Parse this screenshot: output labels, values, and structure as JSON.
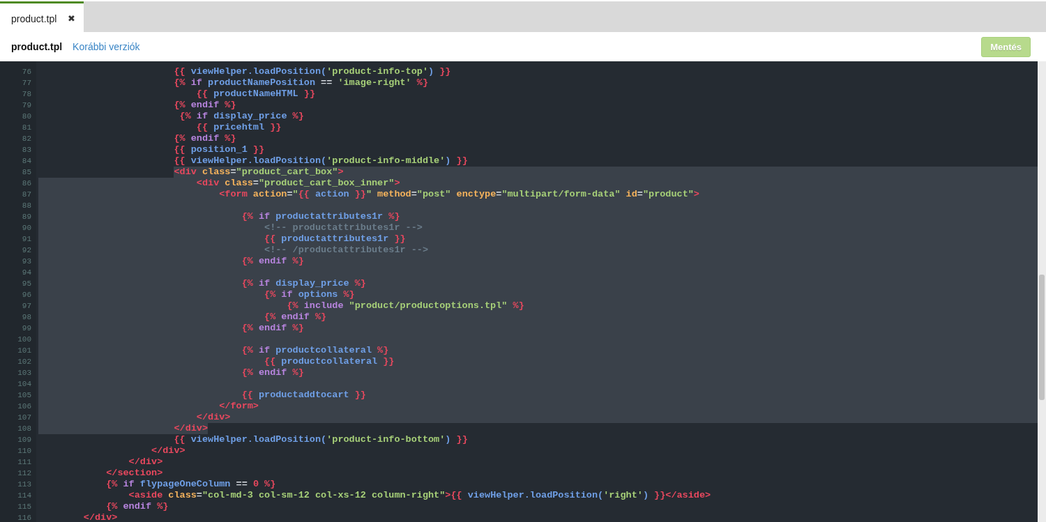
{
  "tabs": [
    {
      "label": "product.tpl",
      "close": "✖",
      "selected": true
    }
  ],
  "toolbar": {
    "file_name": "product.tpl",
    "link": "Korábbi verziók",
    "save_button": {
      "label": "Mentés",
      "disabled": true
    }
  },
  "editor": {
    "lines": [
      {
        "number": "76",
        "selected": false,
        "tokens": [
          {
            "kind": "delim",
            "text": "                        {{"
          },
          {
            "kind": "var",
            "text": " viewHelper.loadPosition("
          },
          {
            "kind": "str",
            "text": "'product-info-top'"
          },
          {
            "kind": "var",
            "text": ") "
          },
          {
            "kind": "delim",
            "text": "}}"
          }
        ]
      },
      {
        "number": "77",
        "selected": false,
        "tokens": [
          {
            "kind": "delim",
            "text": "                        {%"
          },
          {
            "kind": "kw",
            "text": " if"
          },
          {
            "kind": "var",
            "text": " productNamePosition"
          },
          {
            "kind": "op",
            "text": " =="
          },
          {
            "kind": "str",
            "text": " 'image-right'"
          },
          {
            "kind": "delim",
            "text": " %}"
          }
        ]
      },
      {
        "number": "78",
        "selected": false,
        "tokens": [
          {
            "kind": "delim",
            "text": "                            {{"
          },
          {
            "kind": "var",
            "text": " productNameHTML "
          },
          {
            "kind": "delim",
            "text": "}}"
          }
        ]
      },
      {
        "number": "79",
        "selected": false,
        "tokens": [
          {
            "kind": "delim",
            "text": "                        {%"
          },
          {
            "kind": "kw",
            "text": " endif"
          },
          {
            "kind": "delim",
            "text": " %}"
          }
        ]
      },
      {
        "number": "80",
        "selected": false,
        "tokens": [
          {
            "kind": "delim",
            "text": "                         {%"
          },
          {
            "kind": "kw",
            "text": " if"
          },
          {
            "kind": "var",
            "text": " display_price"
          },
          {
            "kind": "delim",
            "text": " %}"
          }
        ]
      },
      {
        "number": "81",
        "selected": false,
        "tokens": [
          {
            "kind": "delim",
            "text": "                            {{"
          },
          {
            "kind": "var",
            "text": " pricehtml "
          },
          {
            "kind": "delim",
            "text": "}}"
          }
        ]
      },
      {
        "number": "82",
        "selected": false,
        "tokens": [
          {
            "kind": "delim",
            "text": "                        {%"
          },
          {
            "kind": "kw",
            "text": " endif"
          },
          {
            "kind": "delim",
            "text": " %}"
          }
        ]
      },
      {
        "number": "83",
        "selected": false,
        "tokens": [
          {
            "kind": "delim",
            "text": "                        {{"
          },
          {
            "kind": "var",
            "text": " position_1 "
          },
          {
            "kind": "delim",
            "text": "}}"
          }
        ]
      },
      {
        "number": "84",
        "selected": false,
        "tokens": [
          {
            "kind": "delim",
            "text": "                        {{"
          },
          {
            "kind": "var",
            "text": " viewHelper.loadPosition("
          },
          {
            "kind": "str",
            "text": "'product-info-middle'"
          },
          {
            "kind": "var",
            "text": ") "
          },
          {
            "kind": "delim",
            "text": "}}"
          }
        ]
      },
      {
        "number": "85",
        "selected": true,
        "tokens": [
          {
            "kind": "tag",
            "text": "                        <div"
          },
          {
            "kind": "attr",
            "text": " class"
          },
          {
            "kind": "op",
            "text": "="
          },
          {
            "kind": "str",
            "text": "\"product_cart_box\""
          },
          {
            "kind": "tag",
            "text": ">"
          }
        ]
      },
      {
        "number": "86",
        "selected": true,
        "tokens": [
          {
            "kind": "tag",
            "text": "                            <div"
          },
          {
            "kind": "attr",
            "text": " class"
          },
          {
            "kind": "op",
            "text": "="
          },
          {
            "kind": "str",
            "text": "\"product_cart_box_inner\""
          },
          {
            "kind": "tag",
            "text": ">"
          }
        ]
      },
      {
        "number": "87",
        "selected": true,
        "tokens": [
          {
            "kind": "tag",
            "text": "                                <form"
          },
          {
            "kind": "attr",
            "text": " action"
          },
          {
            "kind": "op",
            "text": "="
          },
          {
            "kind": "str",
            "text": "\""
          },
          {
            "kind": "delim",
            "text": "{{"
          },
          {
            "kind": "var",
            "text": " action "
          },
          {
            "kind": "delim",
            "text": "}}"
          },
          {
            "kind": "str",
            "text": "\""
          },
          {
            "kind": "attr",
            "text": " method"
          },
          {
            "kind": "op",
            "text": "="
          },
          {
            "kind": "str",
            "text": "\"post\""
          },
          {
            "kind": "attr",
            "text": " enctype"
          },
          {
            "kind": "op",
            "text": "="
          },
          {
            "kind": "str",
            "text": "\"multipart/form-data\""
          },
          {
            "kind": "attr",
            "text": " id"
          },
          {
            "kind": "op",
            "text": "="
          },
          {
            "kind": "str",
            "text": "\"product\""
          },
          {
            "kind": "tag",
            "text": ">"
          }
        ]
      },
      {
        "number": "88",
        "selected": true
      },
      {
        "number": "89",
        "selected": true,
        "tokens": [
          {
            "kind": "delim",
            "text": "                                    {%"
          },
          {
            "kind": "kw",
            "text": " if"
          },
          {
            "kind": "var",
            "text": " productattributes1r"
          },
          {
            "kind": "delim",
            "text": " %}"
          }
        ]
      },
      {
        "number": "90",
        "selected": true,
        "tokens": [
          {
            "kind": "cmt",
            "text": "                                        <!-- productattributes1r -->"
          }
        ]
      },
      {
        "number": "91",
        "selected": true,
        "tokens": [
          {
            "kind": "delim",
            "text": "                                        {{"
          },
          {
            "kind": "var",
            "text": " productattributes1r "
          },
          {
            "kind": "delim",
            "text": "}}"
          }
        ]
      },
      {
        "number": "92",
        "selected": true,
        "tokens": [
          {
            "kind": "cmt",
            "text": "                                        <!-- /productattributes1r -->"
          }
        ]
      },
      {
        "number": "93",
        "selected": true,
        "tokens": [
          {
            "kind": "delim",
            "text": "                                    {%"
          },
          {
            "kind": "kw",
            "text": " endif"
          },
          {
            "kind": "delim",
            "text": " %}"
          }
        ]
      },
      {
        "number": "94",
        "selected": true
      },
      {
        "number": "95",
        "selected": true,
        "tokens": [
          {
            "kind": "delim",
            "text": "                                    {%"
          },
          {
            "kind": "kw",
            "text": " if"
          },
          {
            "kind": "var",
            "text": " display_price"
          },
          {
            "kind": "delim",
            "text": " %}"
          }
        ]
      },
      {
        "number": "96",
        "selected": true,
        "tokens": [
          {
            "kind": "delim",
            "text": "                                        {%"
          },
          {
            "kind": "kw",
            "text": " if"
          },
          {
            "kind": "var",
            "text": " options"
          },
          {
            "kind": "delim",
            "text": " %}"
          }
        ]
      },
      {
        "number": "97",
        "selected": true,
        "tokens": [
          {
            "kind": "delim",
            "text": "                                            {%"
          },
          {
            "kind": "kw",
            "text": " include"
          },
          {
            "kind": "str",
            "text": " \"product/productoptions.tpl\""
          },
          {
            "kind": "delim",
            "text": " %}"
          }
        ]
      },
      {
        "number": "98",
        "selected": true,
        "tokens": [
          {
            "kind": "delim",
            "text": "                                        {%"
          },
          {
            "kind": "kw",
            "text": " endif"
          },
          {
            "kind": "delim",
            "text": " %}"
          }
        ]
      },
      {
        "number": "99",
        "selected": true,
        "tokens": [
          {
            "kind": "delim",
            "text": "                                    {%"
          },
          {
            "kind": "kw",
            "text": " endif"
          },
          {
            "kind": "delim",
            "text": " %}"
          }
        ]
      },
      {
        "number": "100",
        "selected": true
      },
      {
        "number": "101",
        "selected": true,
        "tokens": [
          {
            "kind": "delim",
            "text": "                                    {%"
          },
          {
            "kind": "kw",
            "text": " if"
          },
          {
            "kind": "var",
            "text": " productcollateral"
          },
          {
            "kind": "delim",
            "text": " %}"
          }
        ]
      },
      {
        "number": "102",
        "selected": true,
        "tokens": [
          {
            "kind": "delim",
            "text": "                                        {{"
          },
          {
            "kind": "var",
            "text": " productcollateral "
          },
          {
            "kind": "delim",
            "text": "}}"
          }
        ]
      },
      {
        "number": "103",
        "selected": true,
        "tokens": [
          {
            "kind": "delim",
            "text": "                                    {%"
          },
          {
            "kind": "kw",
            "text": " endif"
          },
          {
            "kind": "delim",
            "text": " %}"
          }
        ]
      },
      {
        "number": "104",
        "selected": true
      },
      {
        "number": "105",
        "selected": true,
        "tokens": [
          {
            "kind": "delim",
            "text": "                                    {{"
          },
          {
            "kind": "var",
            "text": " productaddtocart "
          },
          {
            "kind": "delim",
            "text": "}}"
          }
        ]
      },
      {
        "number": "106",
        "selected": true,
        "tokens": [
          {
            "kind": "tag",
            "text": "                                </form>"
          }
        ]
      },
      {
        "number": "107",
        "selected": true,
        "tokens": [
          {
            "kind": "tag",
            "text": "                            </div>"
          }
        ]
      },
      {
        "number": "108",
        "selected": true,
        "tokens": [
          {
            "kind": "tag",
            "text": "                        </div>"
          }
        ]
      },
      {
        "number": "109",
        "selected": false,
        "tokens": [
          {
            "kind": "delim",
            "text": "                        {{"
          },
          {
            "kind": "var",
            "text": " viewHelper.loadPosition("
          },
          {
            "kind": "str",
            "text": "'product-info-bottom'"
          },
          {
            "kind": "var",
            "text": ") "
          },
          {
            "kind": "delim",
            "text": "}}"
          }
        ]
      },
      {
        "number": "110",
        "selected": false,
        "tokens": [
          {
            "kind": "tag",
            "text": "                    </div>"
          }
        ]
      },
      {
        "number": "111",
        "selected": false,
        "tokens": [
          {
            "kind": "tag",
            "text": "                </div>"
          }
        ]
      },
      {
        "number": "112",
        "selected": false,
        "tokens": [
          {
            "kind": "tag",
            "text": "            </section>"
          }
        ]
      },
      {
        "number": "113",
        "selected": false,
        "tokens": [
          {
            "kind": "delim",
            "text": "            {%"
          },
          {
            "kind": "kw",
            "text": " if"
          },
          {
            "kind": "var",
            "text": " flypageOneColumn"
          },
          {
            "kind": "op",
            "text": " =="
          },
          {
            "kind": "num",
            "text": " 0"
          },
          {
            "kind": "delim",
            "text": " %}"
          }
        ]
      },
      {
        "number": "114",
        "selected": false,
        "tokens": [
          {
            "kind": "tag",
            "text": "                <aside"
          },
          {
            "kind": "attr",
            "text": " class"
          },
          {
            "kind": "op",
            "text": "="
          },
          {
            "kind": "str",
            "text": "\"col-md-3 col-sm-12 col-xs-12 column-right\""
          },
          {
            "kind": "tag",
            "text": ">"
          },
          {
            "kind": "delim",
            "text": "{{"
          },
          {
            "kind": "var",
            "text": " viewHelper.loadPosition("
          },
          {
            "kind": "str",
            "text": "'right'"
          },
          {
            "kind": "var",
            "text": ") "
          },
          {
            "kind": "delim",
            "text": "}}"
          },
          {
            "kind": "tag",
            "text": "</aside>"
          }
        ]
      },
      {
        "number": "115",
        "selected": false,
        "tokens": [
          {
            "kind": "delim",
            "text": "            {%"
          },
          {
            "kind": "kw",
            "text": " endif"
          },
          {
            "kind": "delim",
            "text": " %}"
          }
        ]
      },
      {
        "number": "116",
        "selected": false,
        "tokens": [
          {
            "kind": "tag",
            "text": "        </div>"
          }
        ]
      }
    ]
  }
}
